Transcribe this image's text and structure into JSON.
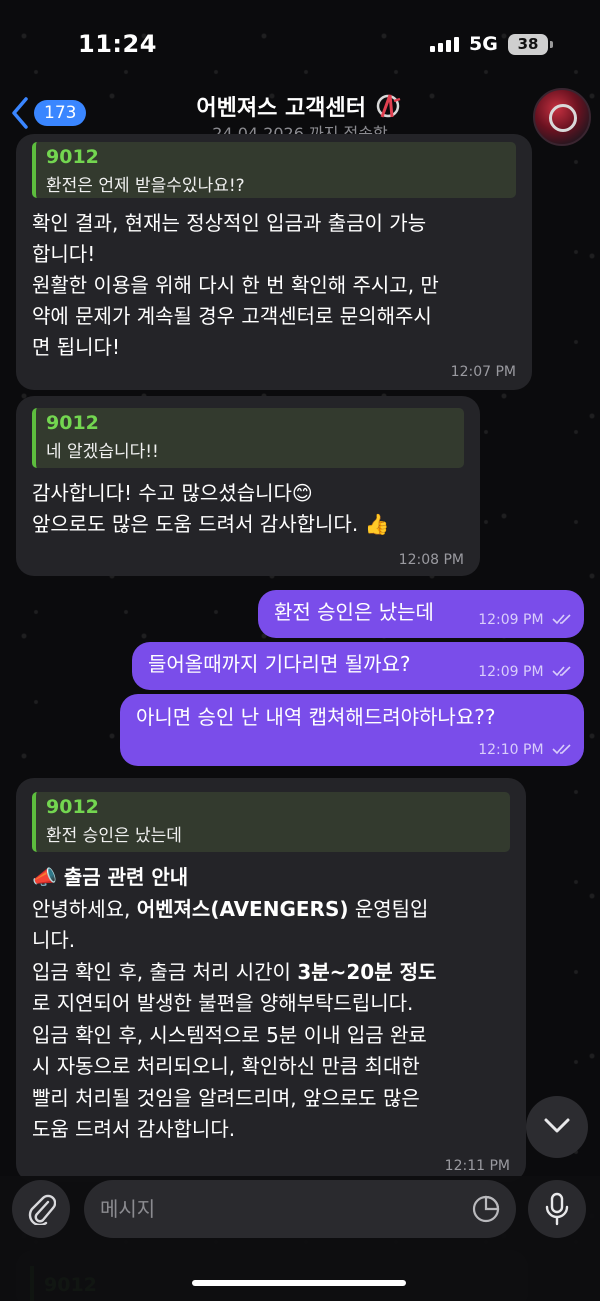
{
  "status": {
    "time": "11:24",
    "network": "5G",
    "battery": "38"
  },
  "header": {
    "back_count": "173",
    "title": "어벤져스 고객센터",
    "subtitle": "24.04.2026.까지 접속함"
  },
  "messages": [
    {
      "direction": "in",
      "reply": {
        "name": "9012",
        "text": "환전은 언제 받을수있나요!?"
      },
      "lines": [
        "확인 결과, 현재는 정상적인 입금과 출금이 가능",
        "합니다!",
        "원활한 이용을 위해 다시 한 번 확인해 주시고, 만",
        "약에 문제가 계속될 경우 고객센터로 문의해주시",
        "면 됩니다!"
      ],
      "time": "12:07 PM"
    },
    {
      "direction": "in",
      "reply": {
        "name": "9012",
        "text": "네 알겠습니다!!"
      },
      "lines": [
        "감사합니다! 수고 많으셨습니다😊",
        "앞으로도 많은 도움 드려서 감사합니다. 👍"
      ],
      "time": "12:08 PM"
    },
    {
      "direction": "out",
      "text": "환전 승인은 났는데",
      "time": "12:09 PM"
    },
    {
      "direction": "out",
      "text": "들어올때까지 기다리면 될까요?",
      "time": "12:09 PM"
    },
    {
      "direction": "out",
      "text": "아니면 승인 난 내역 캡쳐해드려야하나요??",
      "time": "12:10 PM"
    },
    {
      "direction": "in",
      "reply": {
        "name": "9012",
        "text": "환전 승인은 났는데"
      },
      "heading": "📣 출금 관련 안내",
      "line1_a": "안녕하세요, ",
      "line1_b": "어벤져스(AVENGERS)",
      "line1_c": " 운영팀입",
      "line2": "니다.",
      "line3_a": "입금 확인 후, 출금 처리 시간이 ",
      "line3_b": "3분~20분 정도",
      "line4": "로 지연되어 발생한 불편을 양해부탁드립니다.",
      "line5": "입금 확인 후, 시스템적으로 5분 이내 입금 완료",
      "line6": "시 자동으로 처리되오니, 확인하신 만큼 최대한",
      "line7": "빨리 처리될 것임을 알려드리며, 앞으로도 많은",
      "line8": "도움 드려서 감사합니다.",
      "time": "12:11 PM"
    }
  ],
  "peek": {
    "name": "9012"
  },
  "input": {
    "placeholder": "메시지"
  },
  "colors": {
    "incoming": "#242428",
    "outgoing": "#7a4dea",
    "reply_accent": "#5dbd3e",
    "link_badge": "#3a86ff"
  }
}
